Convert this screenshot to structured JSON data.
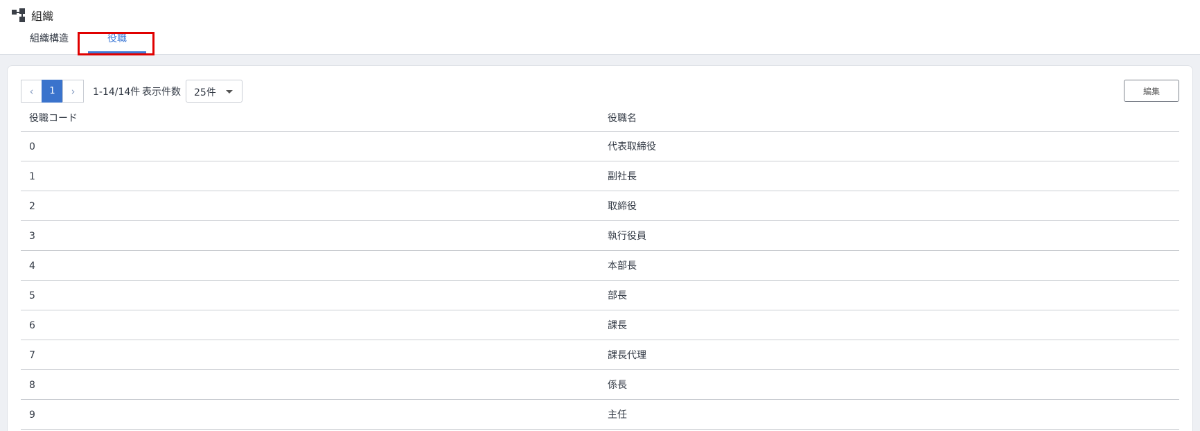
{
  "header": {
    "title": "組織",
    "icon": "org-chart-icon"
  },
  "tabs": [
    {
      "label": "組織構造",
      "active": false
    },
    {
      "label": "役職",
      "active": true
    }
  ],
  "colors": {
    "accent": "#3f7ad6",
    "highlight": "#e00000",
    "pager_active": "#3a73cc"
  },
  "toolbar": {
    "pager": {
      "prev": "‹",
      "current_page": "1",
      "next": "›"
    },
    "range_text": "1-14/14件",
    "page_size_label": "表示件数",
    "page_size_value": "25件",
    "edit_label": "編集"
  },
  "table": {
    "columns": [
      "役職コード",
      "役職名"
    ],
    "rows": [
      {
        "code": "0",
        "name": "代表取締役"
      },
      {
        "code": "1",
        "name": "副社長"
      },
      {
        "code": "2",
        "name": "取締役"
      },
      {
        "code": "3",
        "name": "執行役員"
      },
      {
        "code": "4",
        "name": "本部長"
      },
      {
        "code": "5",
        "name": "部長"
      },
      {
        "code": "6",
        "name": "課長"
      },
      {
        "code": "7",
        "name": "課長代理"
      },
      {
        "code": "8",
        "name": "係長"
      },
      {
        "code": "9",
        "name": "主任"
      }
    ]
  }
}
